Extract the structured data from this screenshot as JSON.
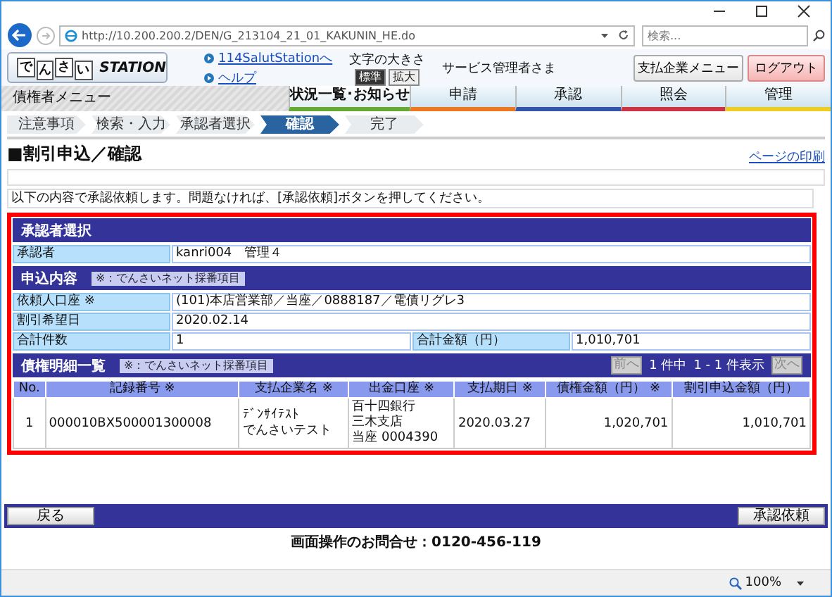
{
  "browser": {
    "url": "http://10.200.200.2/DEN/G_213104_21_01_KAKUNIN_HE.do",
    "search_placeholder": "検索...",
    "zoom": "100%"
  },
  "header": {
    "logo_chars": [
      "で",
      "ん",
      "さ",
      "い"
    ],
    "logo_word": "STATION",
    "links": [
      "114SalutStationへ",
      "ヘルプ"
    ],
    "font_size_label": "文字の大きさ",
    "font_size_options": [
      {
        "label": "標準",
        "selected": true
      },
      {
        "label": "拡大",
        "selected": false
      }
    ],
    "user": "サービス管理者さま",
    "buttons": [
      {
        "label": "支払企業メニュー",
        "kind": "normal"
      },
      {
        "label": "ログアウト",
        "kind": "logout"
      }
    ]
  },
  "nav": {
    "title": "債権者メニュー",
    "tabs": [
      {
        "label": "状況一覧･お知らせ",
        "color": "#66aa33",
        "selected": true
      },
      {
        "label": "申請",
        "color": "#ee7722",
        "selected": false
      },
      {
        "label": "承認",
        "color": "#3355aa",
        "selected": false
      },
      {
        "label": "照会",
        "color": "#cc3344",
        "selected": false
      },
      {
        "label": "管理",
        "color": "#eecc22",
        "selected": false
      }
    ]
  },
  "steps": [
    {
      "label": "注意事項",
      "selected": false
    },
    {
      "label": "検索・入力",
      "selected": false
    },
    {
      "label": "承認者選択",
      "selected": false
    },
    {
      "label": "確認",
      "selected": true
    },
    {
      "label": "完了",
      "selected": false
    }
  ],
  "page_title": "■割引申込／確認",
  "print_link": "ページの印刷",
  "message": "以下の内容で承認依頼します。問題なければ、[承認依頼]ボタンを押してください。",
  "approver_section": {
    "title": "承認者選択",
    "rows": [
      [
        {
          "label": "承認者",
          "value": "kanri004　管理４"
        }
      ]
    ]
  },
  "application_section": {
    "title": "申込内容",
    "note": "※：でんさいネット採番項目",
    "rows": [
      [
        {
          "label": "依頼人口座 ※",
          "value": "(101)本店営業部／当座／0888187／電債リグレ3"
        }
      ],
      [
        {
          "label": "割引希望日",
          "value": "2020.02.14"
        }
      ],
      [
        {
          "label": "合計件数",
          "value": "1"
        },
        {
          "label": "合計金額（円）",
          "value": "1,010,701"
        }
      ]
    ]
  },
  "detail_section": {
    "title": "債権明細一覧",
    "note": "※：でんさいネット採番項目",
    "pager": {
      "prev": {
        "label": "前へ",
        "disabled": true
      },
      "count": "1 件中",
      "range": "1 - 1 件表示",
      "next": {
        "label": "次へ",
        "disabled": true
      }
    },
    "columns": [
      "No.",
      "記録番号 ※",
      "支払企業名 ※",
      "出金口座 ※",
      "支払期日 ※",
      "債権金額（円） ※",
      "割引申込金額（円）"
    ],
    "rows": [
      [
        [
          "1"
        ],
        [
          "000010BX500001300008"
        ],
        [
          "ﾃﾞﾝｻｲﾃｽﾄ",
          "でんさいテスト"
        ],
        [
          "百十四銀行",
          "三木支店",
          "当座 0004390"
        ],
        [
          "2020.03.27"
        ],
        [
          "1,020,701"
        ],
        [
          "1,010,701"
        ]
      ]
    ]
  },
  "bottom_buttons": [
    "戻る",
    "承認依頼"
  ],
  "footer": "画面操作のお問合せ：0120-456-119"
}
